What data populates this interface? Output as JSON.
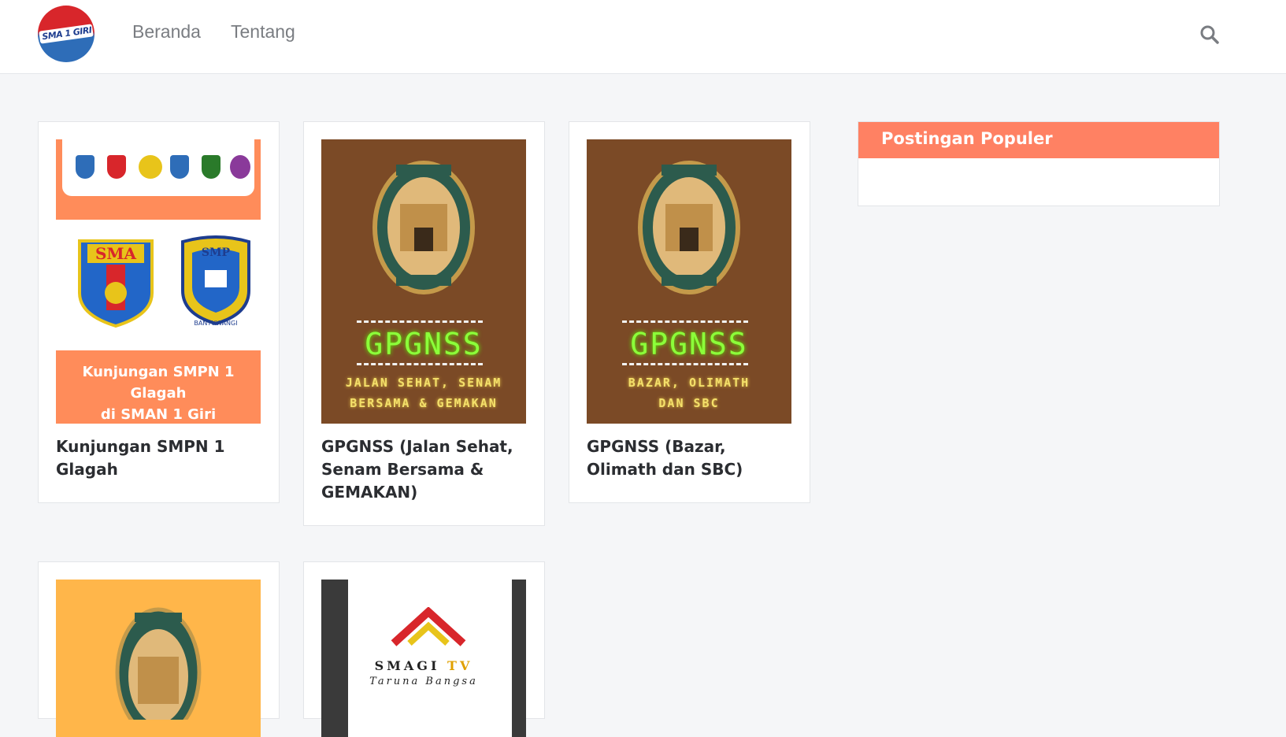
{
  "header": {
    "logo_text": "SMA 1 GIRI",
    "nav": [
      {
        "label": "Beranda"
      },
      {
        "label": "Tentang"
      }
    ]
  },
  "posts": [
    {
      "title": "Kunjungan SMPN 1 Glagah",
      "thumb_caption_line1": "Kunjungan SMPN 1 Glagah",
      "thumb_caption_line2": "di SMAN 1 Giri",
      "shield_left_text": "SMA",
      "shield_right_text": "SMP",
      "shield_right_bottom": "BANYUWANGI"
    },
    {
      "title": "GPGNSS (Jalan Sehat, Senam Bersama & GEMAKAN)",
      "poster_big": "GPGNSS",
      "poster_small_1": "JALAN SEHAT, SENAM",
      "poster_small_2": "BERSAMA & GEMAKAN"
    },
    {
      "title": "GPGNSS (Bazar, Olimath dan SBC)",
      "poster_big": "GPGNSS",
      "poster_small_1": "BAZAR, OLIMATH",
      "poster_small_2": "DAN SBC"
    },
    {
      "title": ""
    },
    {
      "title": "",
      "tv_label_main": "SMAGI ",
      "tv_label_accent": "TV",
      "tv_sub": "Taruna Bangsa"
    }
  ],
  "sidebar": {
    "popular_title": "Postingan Populer"
  },
  "colors": {
    "accent": "#ff8163",
    "thumb_orange": "#ff8c5a",
    "poster_brown": "#7b4a26"
  },
  "icons": {
    "search": "search-icon"
  }
}
